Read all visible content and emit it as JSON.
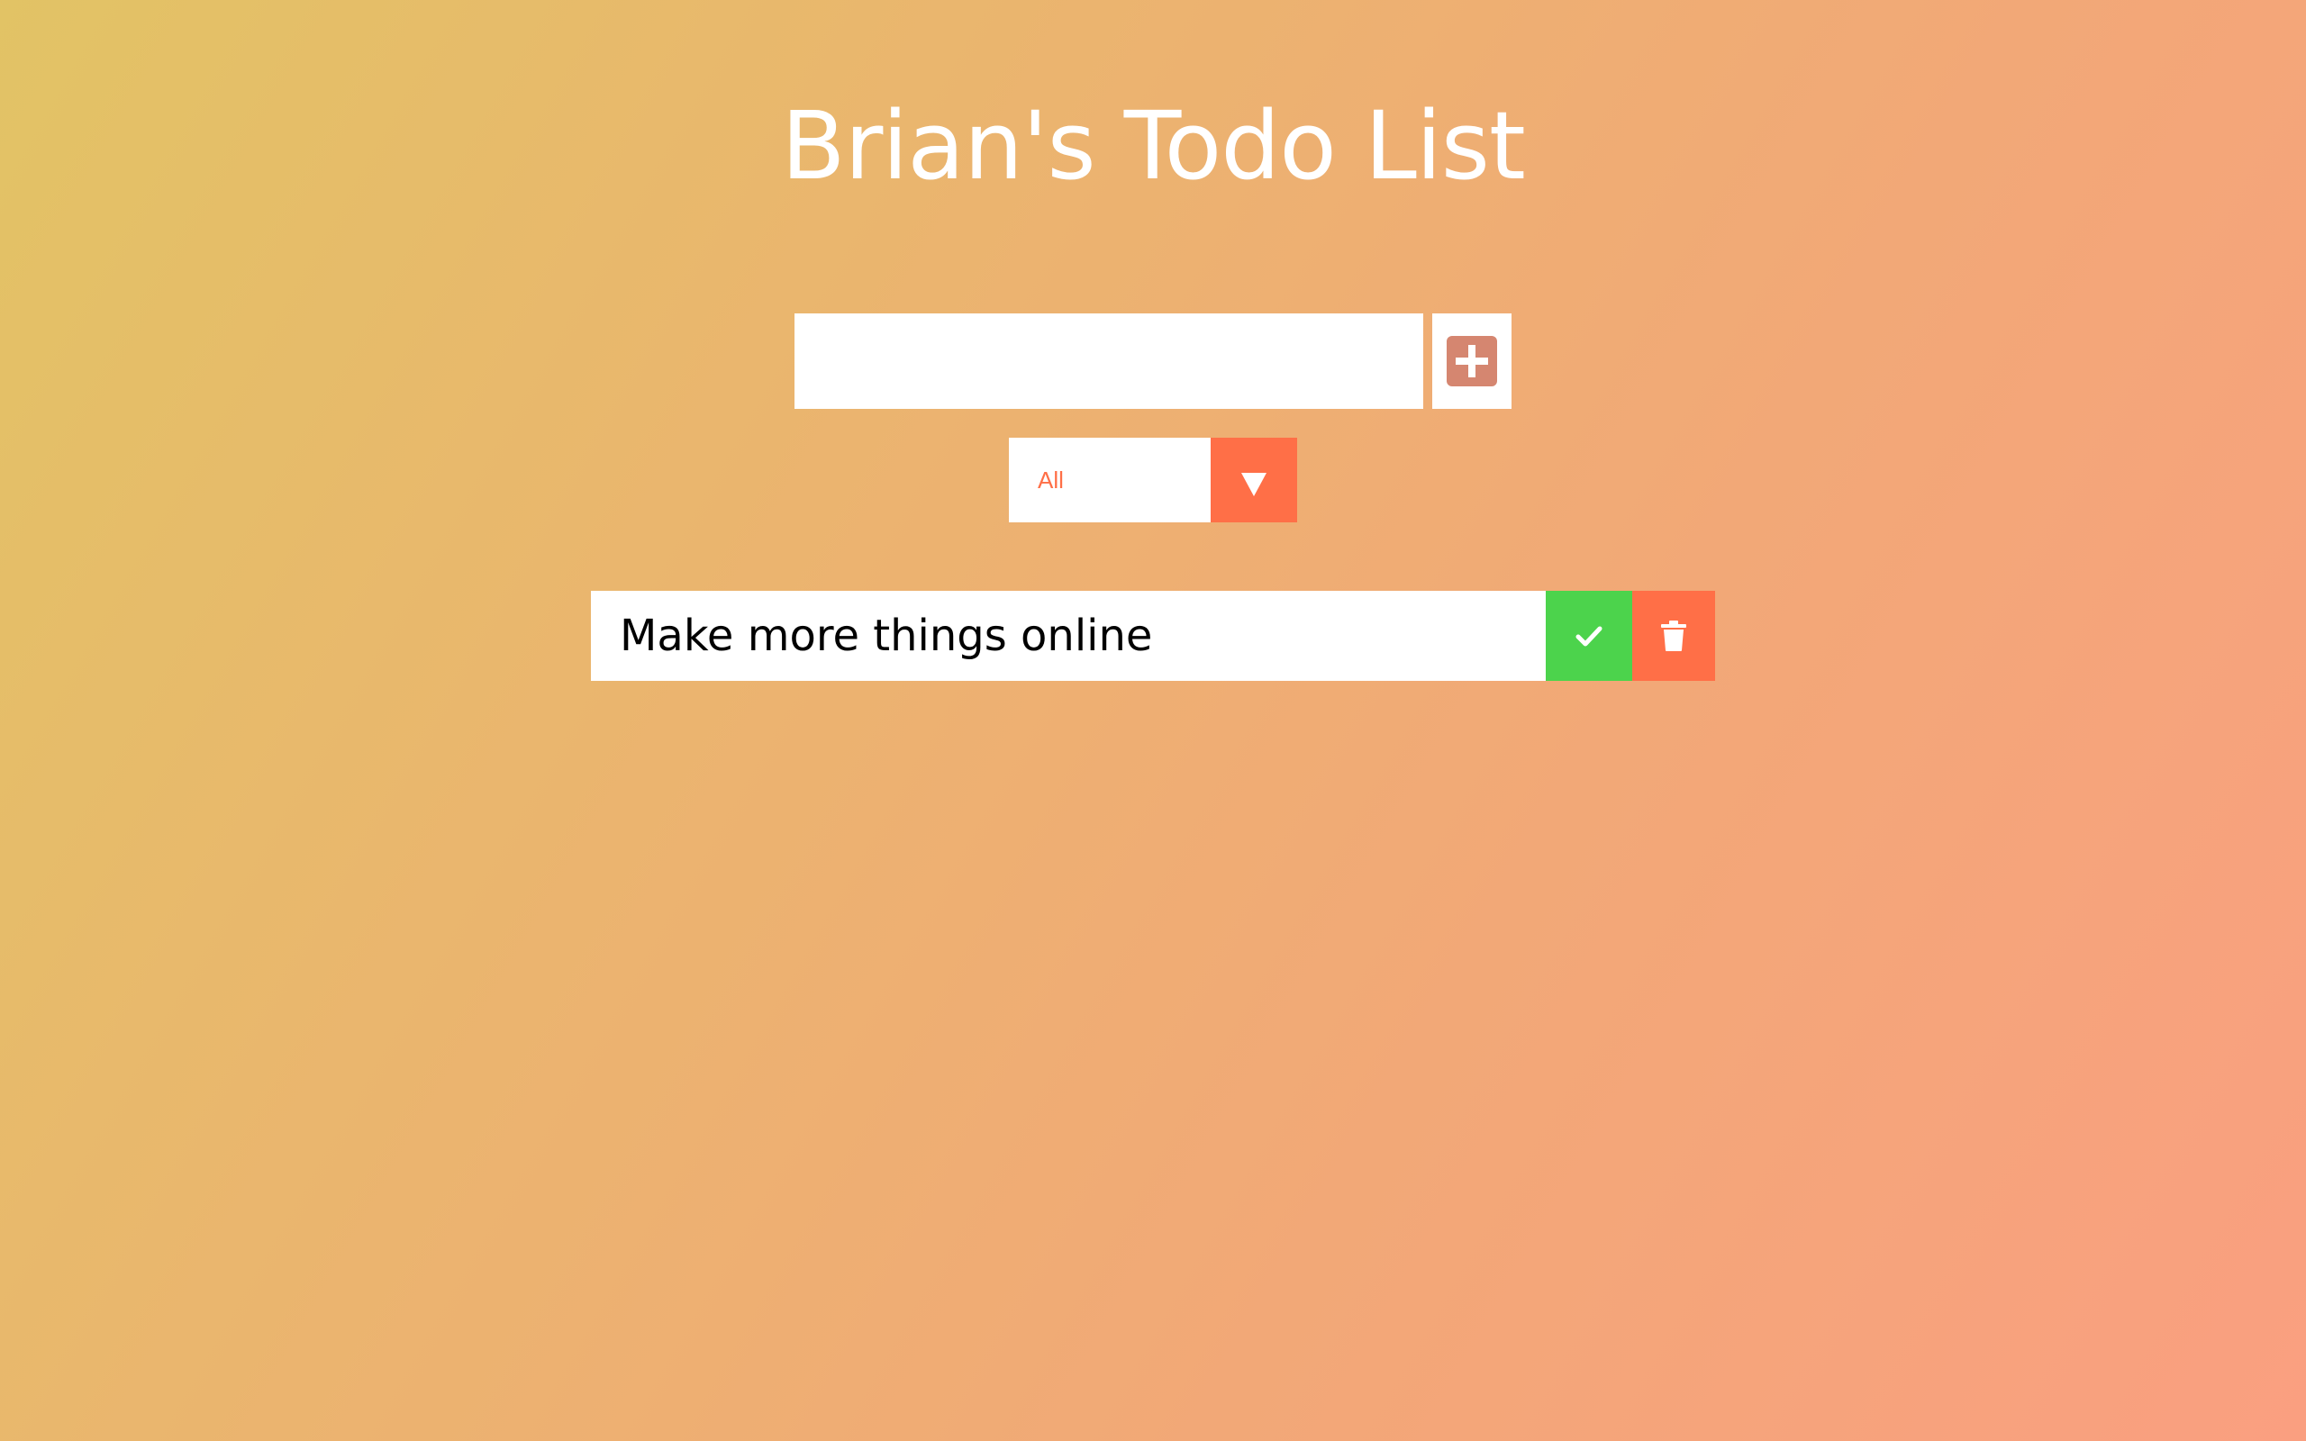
{
  "app": {
    "title": "Brian's Todo List"
  },
  "todo_form": {
    "input_value": "",
    "input_placeholder": "",
    "add_button_icon": "plus-square-icon"
  },
  "filter": {
    "selected": "All",
    "arrow_icon": "chevron-down-icon"
  },
  "todos": [
    {
      "text": "Make more things online",
      "complete_icon": "check-icon",
      "delete_icon": "trash-icon"
    }
  ],
  "colors": {
    "accent": "#ff6f47",
    "complete": "#4cd34c",
    "add_icon": "#d58670",
    "title": "#ffffff"
  }
}
